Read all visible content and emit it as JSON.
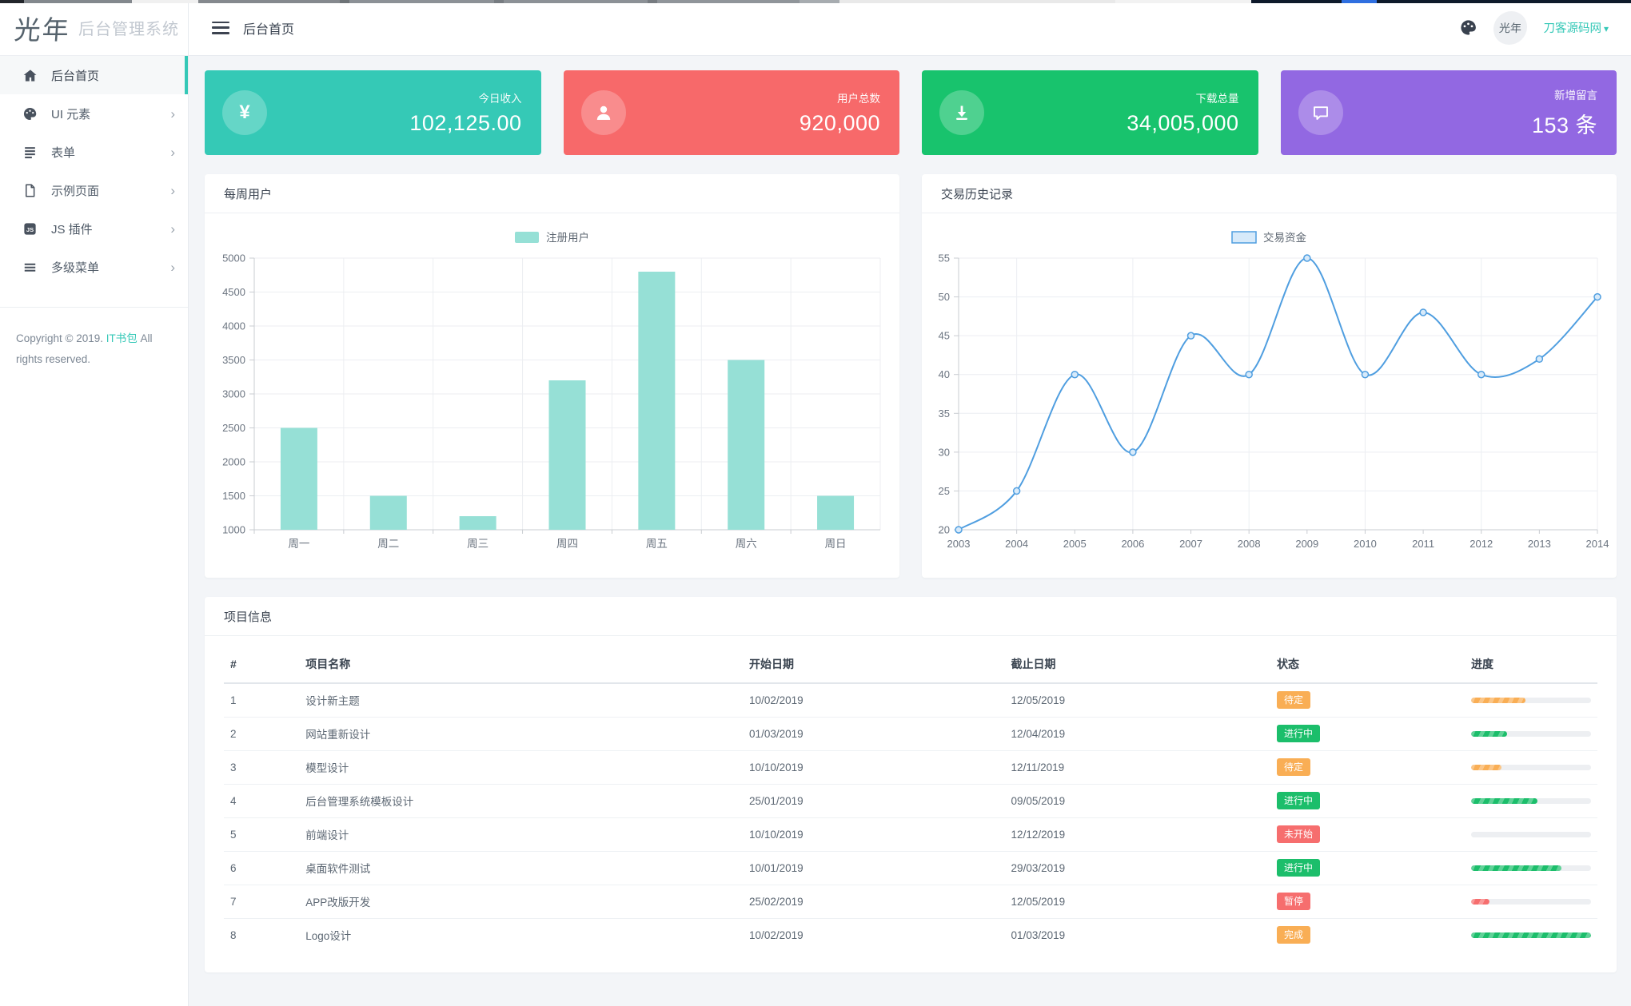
{
  "colors": {
    "accent": "#35c8b7",
    "card_teal": "#35c9b6",
    "card_red": "#f7696a",
    "card_green": "#18c36d",
    "card_purple": "#9268e2",
    "badge_orange": "#f9ae55",
    "badge_green": "#1cbe6b",
    "badge_red": "#f66e6e",
    "bar_fill": "#96e0d6",
    "line_stroke": "#4f9ee0",
    "line_marker_fill": "#d7eafa",
    "grid": "#eceef2",
    "axis": "#c9ccd1",
    "axis_text": "#6b7480"
  },
  "sidebar": {
    "logo_mark": "光年",
    "logo_text": "后台管理系统",
    "items": [
      {
        "label": "后台首页",
        "icon": "home-icon",
        "active": true,
        "expandable": false
      },
      {
        "label": "UI 元素",
        "icon": "palette-icon",
        "active": false,
        "expandable": true
      },
      {
        "label": "表单",
        "icon": "form-icon",
        "active": false,
        "expandable": true
      },
      {
        "label": "示例页面",
        "icon": "page-icon",
        "active": false,
        "expandable": true
      },
      {
        "label": "JS 插件",
        "icon": "js-icon",
        "active": false,
        "expandable": true
      },
      {
        "label": "多级菜单",
        "icon": "menu-icon",
        "active": false,
        "expandable": true
      }
    ],
    "copyright_prefix": "Copyright © 2019.",
    "copyright_link": "IT书包",
    "copyright_suffix": "All rights reserved."
  },
  "header": {
    "title": "后台首页",
    "username": "刀客源码网",
    "caret": "▾"
  },
  "stat_cards": [
    {
      "title": "今日收入",
      "value": "102,125.00",
      "icon": "yen-icon",
      "color_key": "card_teal"
    },
    {
      "title": "用户总数",
      "value": "920,000",
      "icon": "user-icon",
      "color_key": "card_red"
    },
    {
      "title": "下载总量",
      "value": "34,005,000",
      "icon": "download-icon",
      "color_key": "card_green"
    },
    {
      "title": "新增留言",
      "value": "153 条",
      "icon": "message-icon",
      "color_key": "card_purple"
    }
  ],
  "chart_data": [
    {
      "type": "bar",
      "title": "每周用户",
      "legend": "注册用户",
      "legend_position": "top-center",
      "categories": [
        "周一",
        "周二",
        "周三",
        "周四",
        "周五",
        "周六",
        "周日"
      ],
      "values": [
        2500,
        1500,
        1200,
        3200,
        4800,
        3500,
        1500
      ],
      "xlabel": "",
      "ylabel": "",
      "ylim": [
        1000,
        5000
      ],
      "ytick_step": 500,
      "grid": true
    },
    {
      "type": "line",
      "title": "交易历史记录",
      "legend": "交易资金",
      "legend_position": "top-center",
      "x": [
        "2003",
        "2004",
        "2005",
        "2006",
        "2007",
        "2008",
        "2009",
        "2010",
        "2011",
        "2012",
        "2013",
        "2014"
      ],
      "values": [
        20,
        25,
        40,
        30,
        45,
        40,
        55,
        40,
        48,
        40,
        42,
        50
      ],
      "smooth": true,
      "markers": true,
      "xlabel": "",
      "ylabel": "",
      "ylim": [
        20,
        55
      ],
      "ytick_step": 5,
      "grid": true
    }
  ],
  "table": {
    "title": "项目信息",
    "columns": [
      "#",
      "项目名称",
      "开始日期",
      "截止日期",
      "状态",
      "进度"
    ],
    "rows": [
      {
        "num": "1",
        "name": "设计新主题",
        "start": "10/02/2019",
        "end": "12/05/2019",
        "status": "待定",
        "status_color": "orange",
        "progress": 45,
        "progress_color": "orange"
      },
      {
        "num": "2",
        "name": "网站重新设计",
        "start": "01/03/2019",
        "end": "12/04/2019",
        "status": "进行中",
        "status_color": "green",
        "progress": 30,
        "progress_color": "green"
      },
      {
        "num": "3",
        "name": "模型设计",
        "start": "10/10/2019",
        "end": "12/11/2019",
        "status": "待定",
        "status_color": "orange",
        "progress": 25,
        "progress_color": "orange"
      },
      {
        "num": "4",
        "name": "后台管理系统模板设计",
        "start": "25/01/2019",
        "end": "09/05/2019",
        "status": "进行中",
        "status_color": "green",
        "progress": 55,
        "progress_color": "green"
      },
      {
        "num": "5",
        "name": "前端设计",
        "start": "10/10/2019",
        "end": "12/12/2019",
        "status": "未开始",
        "status_color": "red",
        "progress": 0,
        "progress_color": "green"
      },
      {
        "num": "6",
        "name": "桌面软件测试",
        "start": "10/01/2019",
        "end": "29/03/2019",
        "status": "进行中",
        "status_color": "green",
        "progress": 75,
        "progress_color": "green"
      },
      {
        "num": "7",
        "name": "APP改版开发",
        "start": "25/02/2019",
        "end": "12/05/2019",
        "status": "暂停",
        "status_color": "red",
        "progress": 15,
        "progress_color": "red"
      },
      {
        "num": "8",
        "name": "Logo设计",
        "start": "10/02/2019",
        "end": "01/03/2019",
        "status": "完成",
        "status_color": "orange",
        "progress": 100,
        "progress_color": "green"
      }
    ]
  }
}
